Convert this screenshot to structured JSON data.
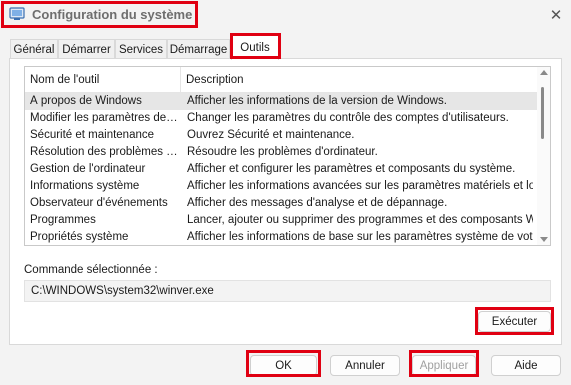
{
  "window": {
    "title": "Configuration du système",
    "app_icon": "system-config-icon",
    "close_glyph": "✕"
  },
  "tabs": [
    {
      "label": "Général",
      "selected": false
    },
    {
      "label": "Démarrer",
      "selected": false
    },
    {
      "label": "Services",
      "selected": false
    },
    {
      "label": "Démarrage",
      "selected": false
    },
    {
      "label": "Outils",
      "selected": true
    }
  ],
  "tools": {
    "headers": {
      "name": "Nom de l'outil",
      "description": "Description"
    },
    "rows": [
      {
        "name": "À propos de Windows",
        "description": "Afficher les informations de la version de Windows."
      },
      {
        "name": "Modifier les paramètres de c...",
        "description": "Changer les paramètres du contrôle des comptes d'utilisateurs."
      },
      {
        "name": "Sécurité et maintenance",
        "description": "Ouvrez Sécurité et maintenance."
      },
      {
        "name": "Résolution des problèmes Wi...",
        "description": "Résoudre les problèmes d'ordinateur."
      },
      {
        "name": "Gestion de l'ordinateur",
        "description": "Afficher et configurer les paramètres et composants du système."
      },
      {
        "name": "Informations système",
        "description": "Afficher les informations avancées sur les paramètres matériels et logicie"
      },
      {
        "name": "Observateur d'événements",
        "description": "Afficher des messages d'analyse et de dépannage."
      },
      {
        "name": "Programmes",
        "description": "Lancer, ajouter ou supprimer des programmes et des composants Windo"
      },
      {
        "name": "Propriétés système",
        "description": "Afficher les informations de base sur les paramètres système de votre o"
      }
    ]
  },
  "command": {
    "label": "Commande sélectionnée :",
    "value": "C:\\WINDOWS\\system32\\winver.exe"
  },
  "buttons": {
    "run": "Exécuter",
    "ok": "OK",
    "cancel": "Annuler",
    "apply": "Appliquer",
    "help": "Aide"
  },
  "colors": {
    "highlight_border": "#e00012",
    "window_bg": "#f3f3f3",
    "selected_row": "#e6e6e6"
  }
}
